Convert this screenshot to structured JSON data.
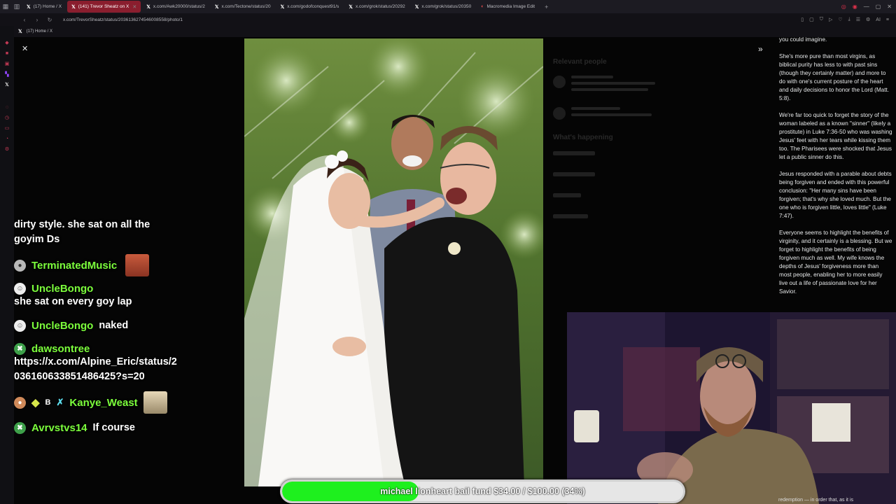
{
  "browser": {
    "tabs": [
      {
        "label": "(17) Home / X",
        "active": false
      },
      {
        "label": "(141) Trevor Sheatz on X",
        "active": true
      },
      {
        "label": "x.com/Awk20000/status/2",
        "active": false
      },
      {
        "label": "x.com/Tectone/status/20",
        "active": false
      },
      {
        "label": "x.com/godofconquest91/s",
        "active": false
      },
      {
        "label": "x.com/grok/status/20292",
        "active": false
      },
      {
        "label": "x.com/grok/status/20350",
        "active": false
      },
      {
        "label": "Macromedia Image Edit",
        "active": false
      }
    ],
    "url": "x.com/TrevorSheatz/status/2036136274546008558/photo/1",
    "bookmark": "(17) Home / X",
    "ai_label": "AI"
  },
  "post": {
    "paragraphs": [
      "you could imagine.",
      "She's more pure than most virgins, as biblical purity has less to with past sins (though they certainly matter) and more to do with one's current posture of the heart and daily decisions to honor the Lord (Matt. 5:8).",
      "We're far too quick to forget the story of the woman labeled as a known \"sinner\" (likely a prostitute) in Luke 7:36-50 who was washing Jesus' feet with her tears while kissing them too. The Pharisees were shocked that Jesus let a public sinner do this.",
      "Jesus responded with a parable about debts being forgiven and ended with this powerful conclusion: \"Her many sins have been forgiven; that's why she loved much. But the one who is forgiven little, loves little\" (Luke 7:47).",
      "Everyone seems to highlight the benefits of virginity, and it certainly is a blessing. But we forget to highlight the benefits of being forgiven much as well. My wife knows the depths of Jesus' forgiveness more than most people, enabling her to more easily live out a life of passionate love for her Savior."
    ],
    "bottom_fragment": "redemption — in order that, as it is"
  },
  "dimmed": {
    "relevant_heading": "Relevant people",
    "trending_heading": "What's happening"
  },
  "chat": {
    "lead_text": "dirty style. she sat on all the goyim Ds",
    "messages": [
      {
        "user": "TerminatedMusic",
        "text": ""
      },
      {
        "user": "UncleBongo",
        "text": "she sat on every goy lap"
      },
      {
        "user": "UncleBongo",
        "text": "naked"
      },
      {
        "user": "dawsontree",
        "text": "https://x.com/Alpine_Eric/status/2036160633851486425?s=20"
      },
      {
        "user": "Kanye_Weast",
        "text": ""
      },
      {
        "user": "Avrvstvs14",
        "text": "If course"
      }
    ]
  },
  "goal": {
    "label": "michael lionheart bail fund $34.00 / $100.00 (34%)",
    "progress": 0.34
  },
  "colors": {
    "username": "#7cff3c",
    "goal_fill": "#1ef01e",
    "active_tab": "#8a1e2e"
  }
}
